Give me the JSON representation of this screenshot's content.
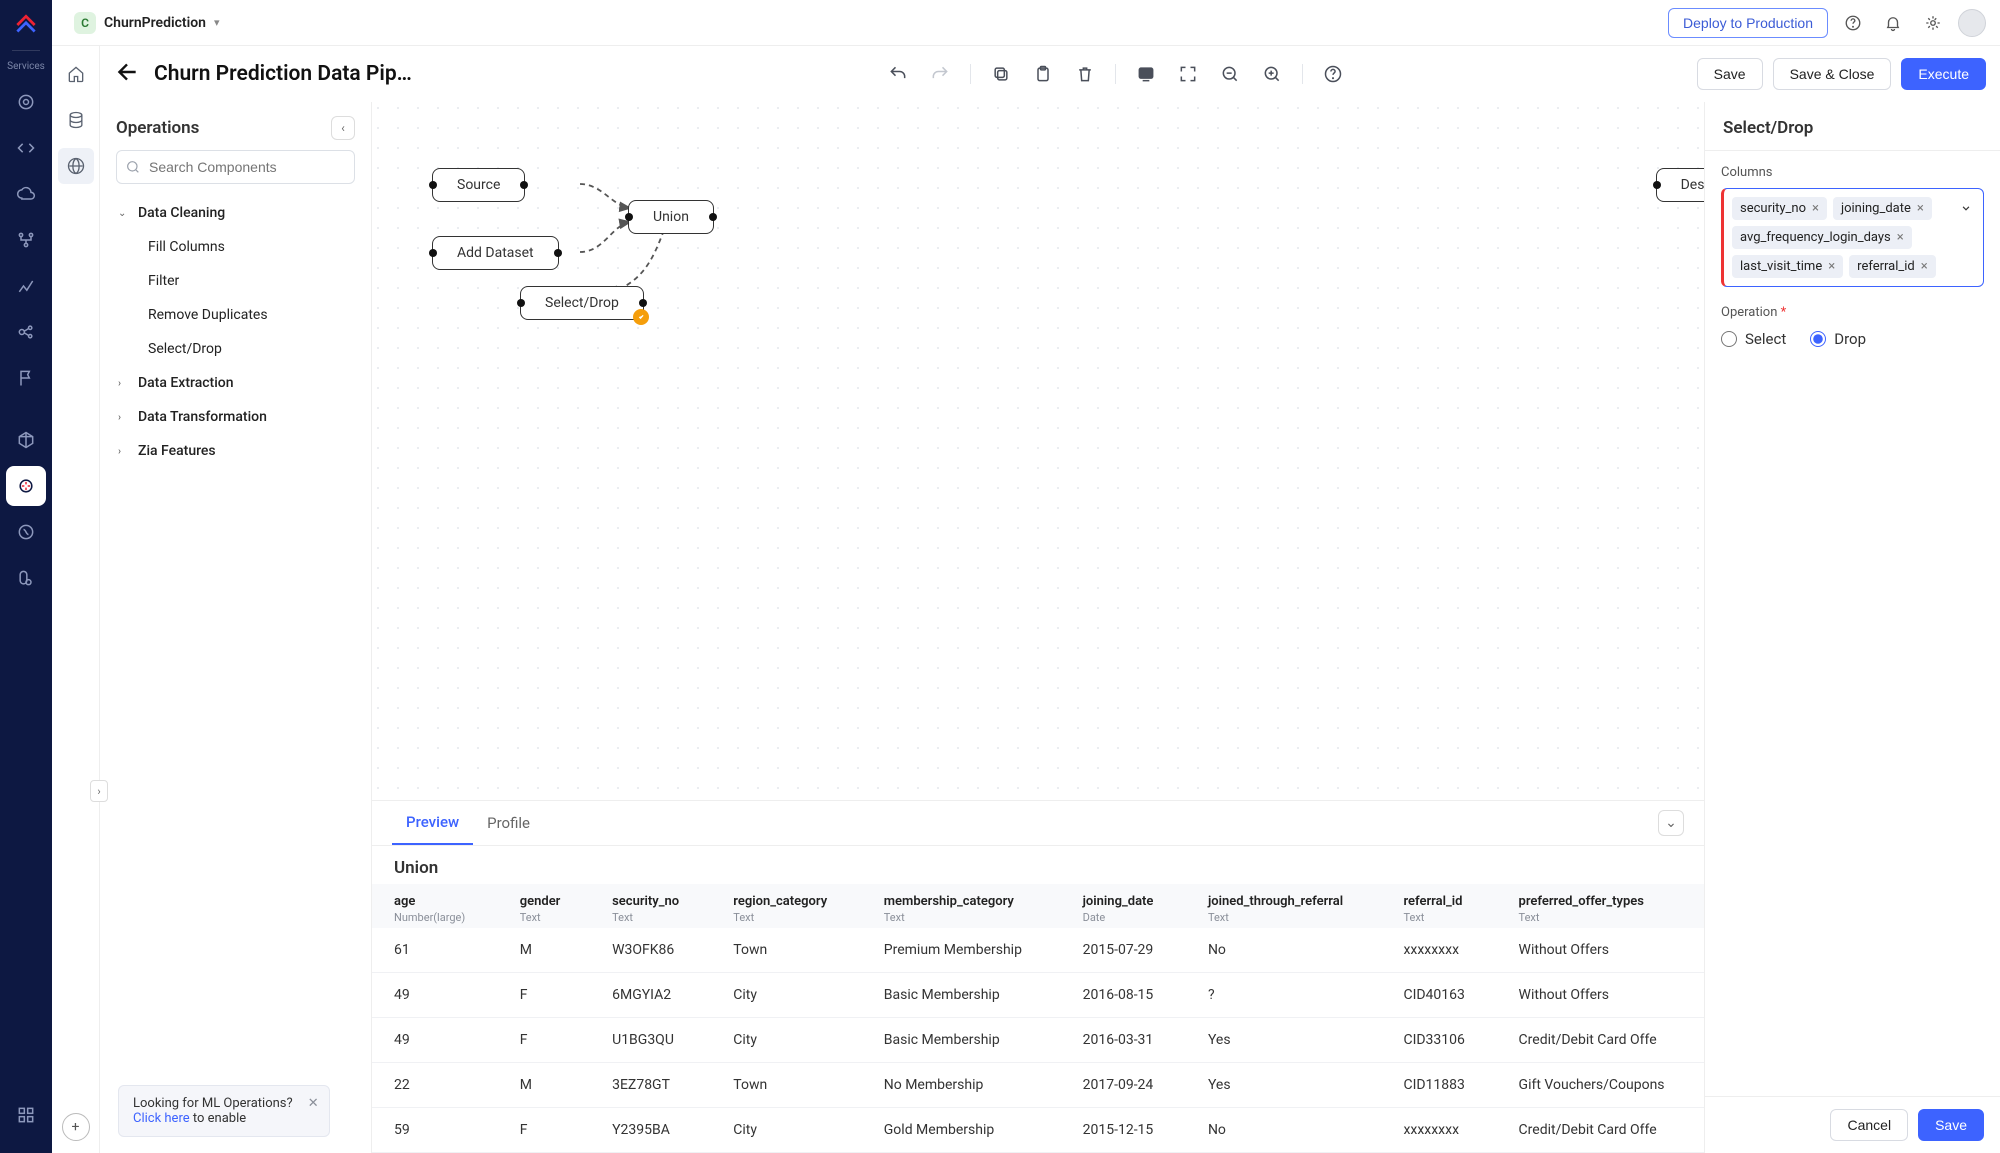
{
  "header": {
    "project_name": "ChurnPrediction",
    "project_initial": "C",
    "deploy_label": "Deploy to Production"
  },
  "services_label": "Services",
  "page": {
    "title": "Churn Prediction Data Pipe...",
    "save": "Save",
    "save_close": "Save & Close",
    "execute": "Execute"
  },
  "ops": {
    "title": "Operations",
    "search_placeholder": "Search Components",
    "groups": [
      {
        "label": "Data Cleaning",
        "expanded": true,
        "children": [
          {
            "label": "Fill Columns"
          },
          {
            "label": "Filter"
          },
          {
            "label": "Remove Duplicates"
          },
          {
            "label": "Select/Drop"
          }
        ]
      },
      {
        "label": "Data Extraction",
        "expanded": false
      },
      {
        "label": "Data Transformation",
        "expanded": false
      },
      {
        "label": "Zia Features",
        "expanded": false
      }
    ]
  },
  "hint": {
    "line1": "Looking for ML Operations?",
    "link_text": "Click here",
    "line2_suffix": " to enable"
  },
  "canvas": {
    "nodes": {
      "source": "Source",
      "add_dataset": "Add Dataset",
      "union": "Union",
      "select_drop": "Select/Drop",
      "dest": "Dest"
    }
  },
  "config": {
    "title": "Select/Drop",
    "columns_label": "Columns",
    "columns": [
      "security_no",
      "joining_date",
      "avg_frequency_login_days",
      "last_visit_time",
      "referral_id"
    ],
    "operation_label": "Operation",
    "op_select": "Select",
    "op_drop": "Drop",
    "op_value": "Drop",
    "cancel": "Cancel",
    "save": "Save"
  },
  "preview": {
    "tabs": {
      "preview": "Preview",
      "profile": "Profile"
    },
    "active_tab": "Preview",
    "title": "Union",
    "columns": [
      {
        "name": "age",
        "type": "Number(large)"
      },
      {
        "name": "gender",
        "type": "Text"
      },
      {
        "name": "security_no",
        "type": "Text"
      },
      {
        "name": "region_category",
        "type": "Text"
      },
      {
        "name": "membership_category",
        "type": "Text"
      },
      {
        "name": "joining_date",
        "type": "Date"
      },
      {
        "name": "joined_through_referral",
        "type": "Text"
      },
      {
        "name": "referral_id",
        "type": "Text"
      },
      {
        "name": "preferred_offer_types",
        "type": "Text"
      }
    ],
    "rows": [
      [
        "61",
        "M",
        "W3OFK86",
        "Town",
        "Premium Membership",
        "2015-07-29",
        "No",
        "xxxxxxxx",
        "Without Offers"
      ],
      [
        "49",
        "F",
        "6MGYIA2",
        "City",
        "Basic Membership",
        "2016-08-15",
        "?",
        "CID40163",
        "Without Offers"
      ],
      [
        "49",
        "F",
        "U1BG3QU",
        "City",
        "Basic Membership",
        "2016-03-31",
        "Yes",
        "CID33106",
        "Credit/Debit Card Offe"
      ],
      [
        "22",
        "M",
        "3EZ78GT",
        "Town",
        "No Membership",
        "2017-09-24",
        "Yes",
        "CID11883",
        "Gift Vouchers/Coupons"
      ],
      [
        "59",
        "F",
        "Y2395BA",
        "City",
        "Gold Membership",
        "2015-12-15",
        "No",
        "xxxxxxxx",
        "Credit/Debit Card Offe"
      ]
    ]
  }
}
